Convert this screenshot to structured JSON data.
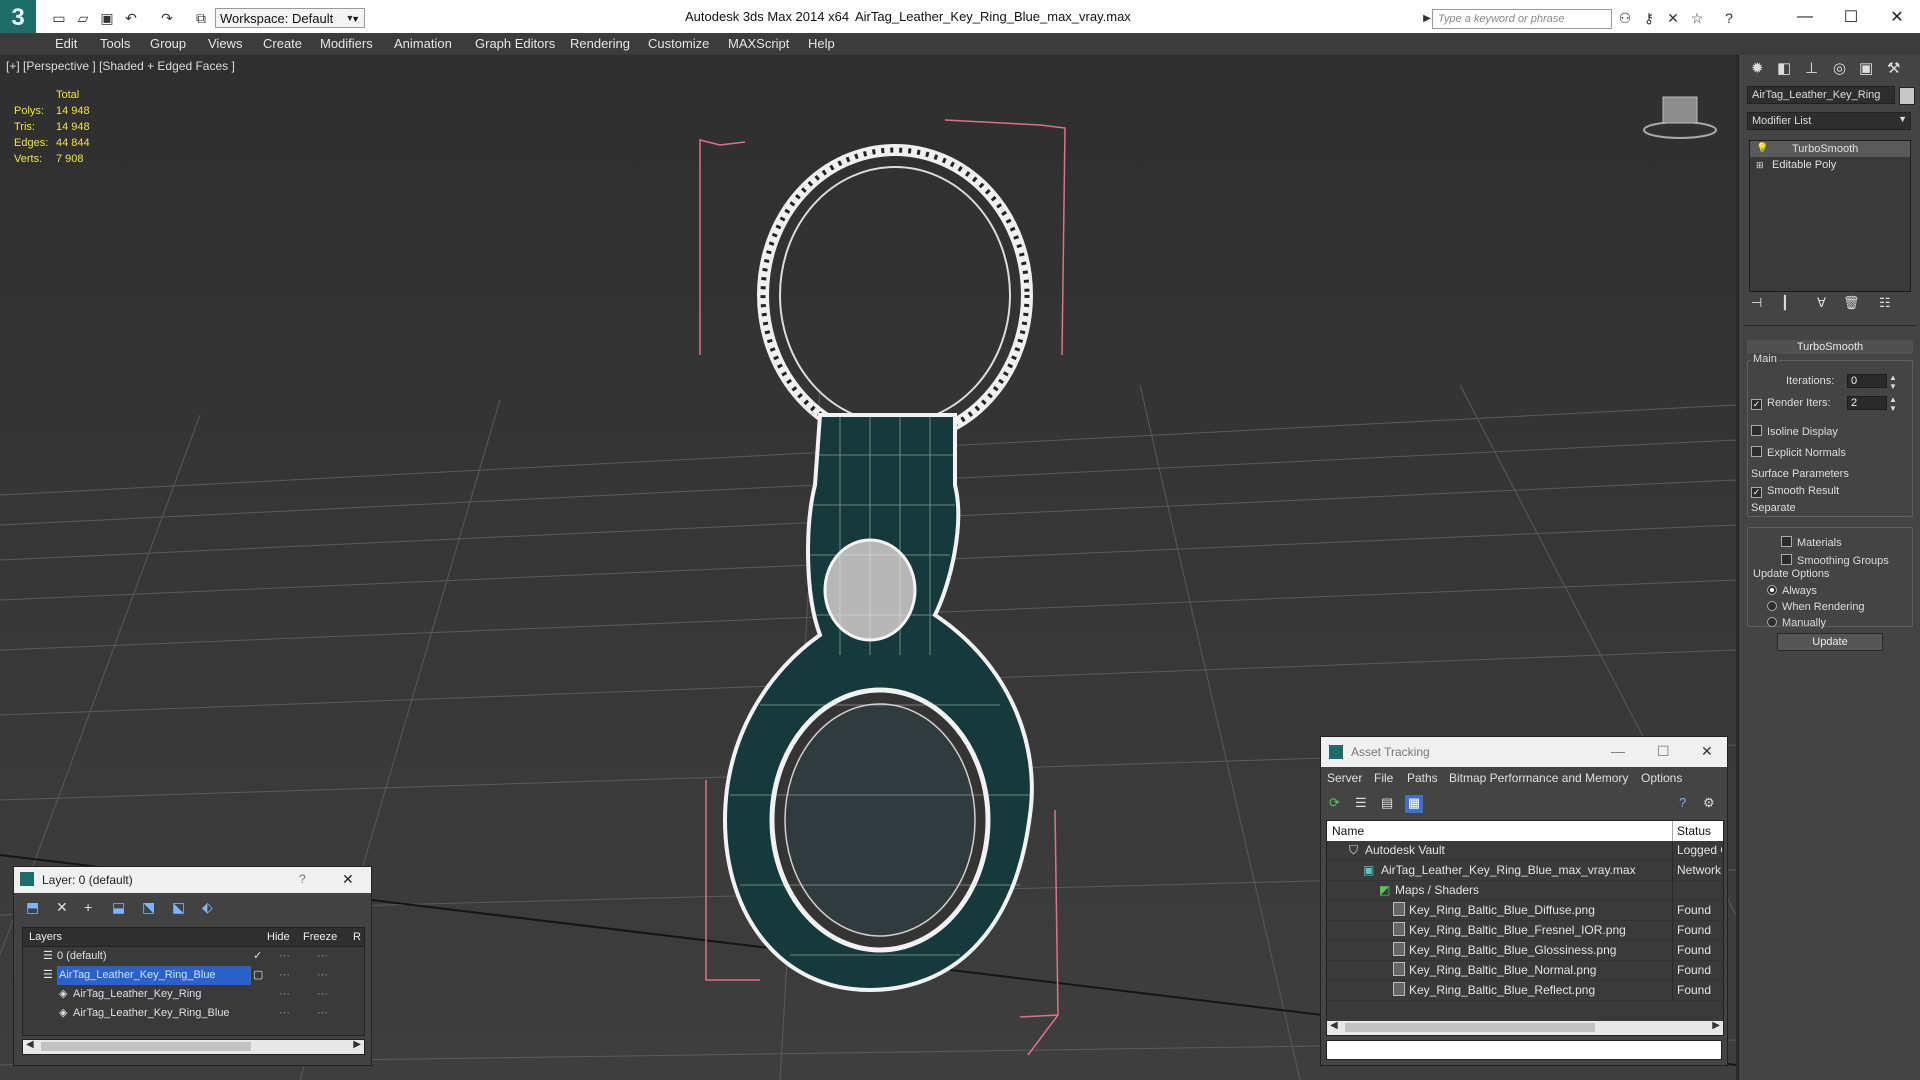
{
  "app": {
    "title": "Autodesk 3ds Max  2014 x64",
    "file": "AirTag_Leather_Key_Ring_Blue_max_vray.max",
    "logo": "3",
    "workspace": "Workspace: Default",
    "search_placeholder": "Type a keyword or phrase"
  },
  "menu": [
    "Edit",
    "Tools",
    "Group",
    "Views",
    "Create",
    "Modifiers",
    "Animation",
    "Graph Editors",
    "Rendering",
    "Customize",
    "MAXScript",
    "Help"
  ],
  "viewport": {
    "label": "[+] [Perspective ] [Shaded + Edged Faces ]",
    "stats": {
      "header": "Total",
      "rows": [
        {
          "label": "Polys:",
          "value": "14 948"
        },
        {
          "label": "Tris:",
          "value": "14 948"
        },
        {
          "label": "Edges:",
          "value": "44 844"
        },
        {
          "label": "Verts:",
          "value": "7 908"
        }
      ]
    }
  },
  "command_panel": {
    "object_name": "AirTag_Leather_Key_Ring",
    "modifier_list": "Modifier List",
    "stack": [
      "TurboSmooth",
      "Editable Poly"
    ],
    "rollout": "TurboSmooth",
    "main": "Main",
    "iterations_label": "Iterations:",
    "iterations_value": "0",
    "render_iters_label": "Render Iters:",
    "render_iters_value": "2",
    "isoline": "Isoline Display",
    "explicit_normals": "Explicit Normals",
    "surface_params": "Surface Parameters",
    "smooth_result": "Smooth Result",
    "separate": "Separate",
    "materials": "Materials",
    "smoothing_groups": "Smoothing Groups",
    "update_options": "Update Options",
    "always": "Always",
    "when_rendering": "When Rendering",
    "manually": "Manually",
    "update_button": "Update"
  },
  "layer_window": {
    "title": "Layer: 0 (default)",
    "help": "?",
    "columns": {
      "layers": "Layers",
      "hide": "Hide",
      "freeze": "Freeze",
      "render": "R"
    },
    "rows": [
      {
        "name": "0 (default)"
      },
      {
        "name": "AirTag_Leather_Key_Ring_Blue"
      },
      {
        "name": "AirTag_Leather_Key_Ring"
      },
      {
        "name": "AirTag_Leather_Key_Ring_Blue"
      }
    ]
  },
  "asset_tracking": {
    "title": "Asset Tracking",
    "menu": [
      "Server",
      "File",
      "Paths",
      "Bitmap Performance and Memory",
      "Options"
    ],
    "columns": {
      "name": "Name",
      "status": "Status"
    },
    "rows": [
      {
        "name": "Autodesk Vault",
        "status": "Logged O"
      },
      {
        "name": "AirTag_Leather_Key_Ring_Blue_max_vray.max",
        "status": "Network P"
      },
      {
        "name": "Maps / Shaders",
        "status": ""
      },
      {
        "name": "Key_Ring_Baltic_Blue_Diffuse.png",
        "status": "Found"
      },
      {
        "name": "Key_Ring_Baltic_Blue_Fresnel_IOR.png",
        "status": "Found"
      },
      {
        "name": "Key_Ring_Baltic_Blue_Glossiness.png",
        "status": "Found"
      },
      {
        "name": "Key_Ring_Baltic_Blue_Normal.png",
        "status": "Found"
      },
      {
        "name": "Key_Ring_Baltic_Blue_Reflect.png",
        "status": "Found"
      }
    ]
  }
}
